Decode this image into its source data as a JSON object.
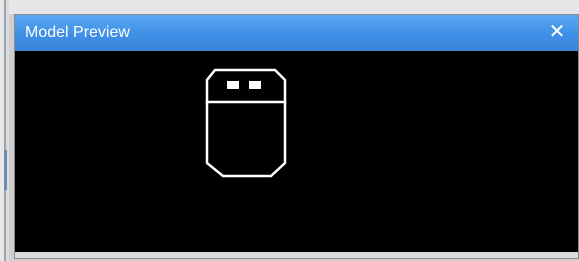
{
  "window": {
    "title": "Model Preview",
    "close_label": "✕"
  },
  "preview": {
    "model_icon": "robot-head-outline-icon",
    "stroke_color": "#ffffff",
    "background_color": "#000000"
  },
  "colors": {
    "titlebar": "#3f8fe6",
    "title_text": "#ffffff"
  }
}
